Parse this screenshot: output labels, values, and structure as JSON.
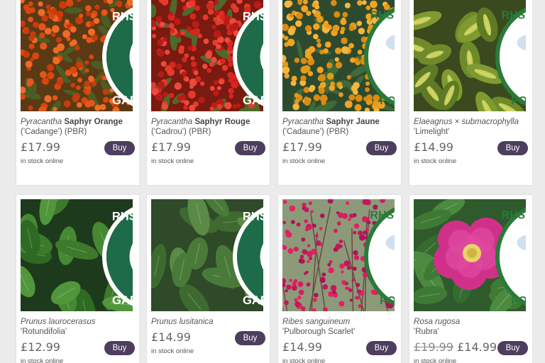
{
  "products": [
    {
      "name_italic": "Pyracantha",
      "name_bold": "Saphyr Orange",
      "name_rest": "('Cadange') (PBR)",
      "price": "£17.99",
      "old_price": "",
      "buy_label": "Buy",
      "stock": "in stock online",
      "badge": "rhs-award-icon",
      "image": "orange-berries"
    },
    {
      "name_italic": "Pyracantha",
      "name_bold": "Saphyr Rouge",
      "name_rest": "('Cadrou') (PBR)",
      "price": "£17.99",
      "old_price": "",
      "buy_label": "Buy",
      "stock": "in stock online",
      "badge": "rhs-award-icon",
      "image": "red-berries"
    },
    {
      "name_italic": "Pyracantha",
      "name_bold": "Saphyr Jaune",
      "name_rest": "('Cadaune') (PBR)",
      "price": "£17.99",
      "old_price": "",
      "buy_label": "Buy",
      "stock": "in stock online",
      "badge": "bee-pollinators-icon",
      "image": "yellow-berries"
    },
    {
      "name_italic": "Elaeagnus × submacrophylla",
      "name_bold": "",
      "name_rest": "'Limelight'",
      "price": "£14.99",
      "old_price": "",
      "buy_label": "Buy",
      "stock": "in stock online",
      "badge": "bee-pollinators-icon",
      "image": "variegated-leaves"
    },
    {
      "name_italic": "Prunus laurocerasus",
      "name_bold": "",
      "name_rest": "'Rotundifolia'",
      "price": "£12.99",
      "old_price": "",
      "buy_label": "Buy",
      "stock": "in stock online",
      "badge": "rhs-award-icon",
      "image": "laurel-leaves"
    },
    {
      "name_italic": "Prunus lusitanica",
      "name_bold": "",
      "name_rest": "",
      "price": "£14.99",
      "old_price": "",
      "buy_label": "Buy",
      "stock": "in stock online",
      "badge": "rhs-award-icon",
      "image": "portugal-laurel"
    },
    {
      "name_italic": "Ribes sanguineum",
      "name_bold": "",
      "name_rest": "'Pulborough Scarlet'",
      "price": "£14.99",
      "old_price": "",
      "buy_label": "Buy",
      "stock": "in stock online",
      "badge": "bee-pollinators-icon",
      "image": "pink-ribes"
    },
    {
      "name_italic": "Rosa rugosa",
      "name_bold": "",
      "name_rest": "'Rubra'",
      "price": "£14.99",
      "old_price": "£19.99",
      "buy_label": "Buy",
      "stock": "in stock online",
      "badge": "bee-pollinators-icon",
      "image": "pink-rose"
    }
  ],
  "badges": {
    "rhs": {
      "top": "RHS AWARD OF",
      "bottom": "GARDEN MERIT"
    },
    "bee": {
      "top": "RHS PLANTS FOR",
      "bottom": "POLLINATORS"
    }
  },
  "colors": {
    "buy_button": "#4d3d5e",
    "rhs_badge": "#1e6b48"
  }
}
